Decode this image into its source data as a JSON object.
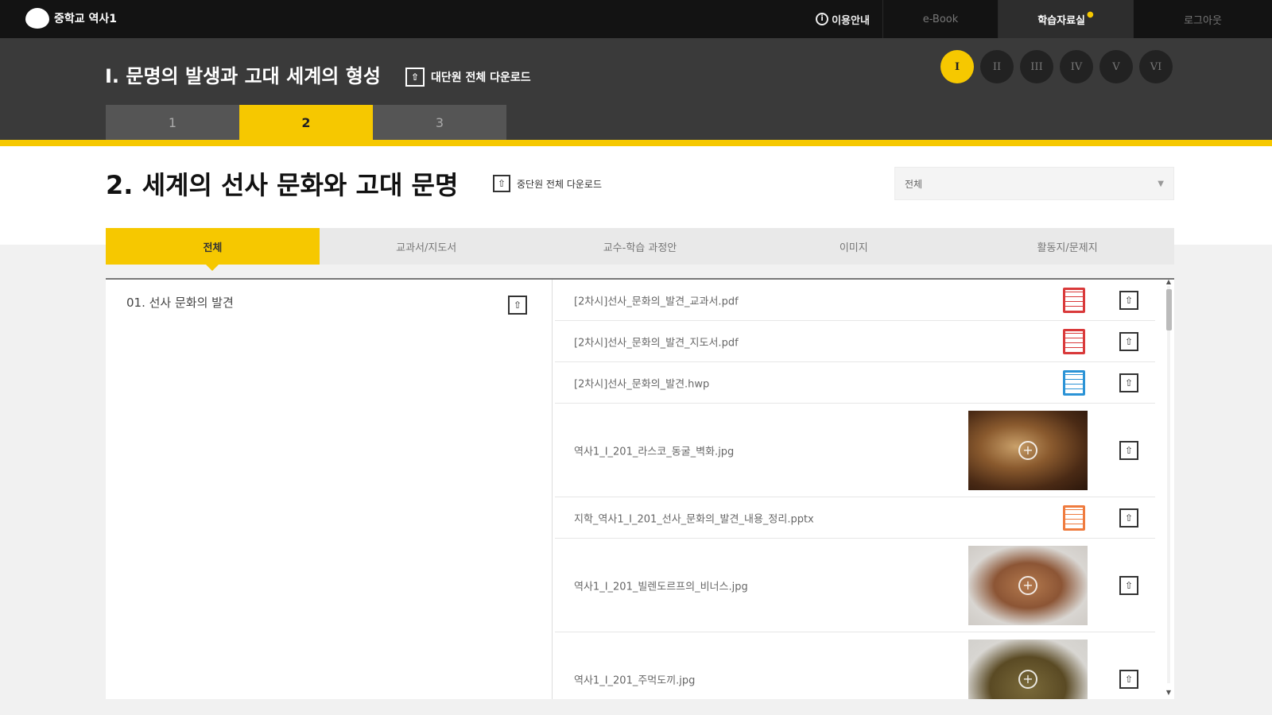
{
  "app": {
    "logo_text": "중학교 역사1"
  },
  "topnav": {
    "guide": "이용안내",
    "ebook": "e-Book",
    "materials": "학습자료실",
    "logout": "로그아웃"
  },
  "unit": {
    "title": "I. 문명의 발생과 고대 세계의 형성",
    "download_label": "대단원 전체 다운로드",
    "circles": [
      "I",
      "II",
      "III",
      "IV",
      "V",
      "VI"
    ],
    "active_circle": "I"
  },
  "chapter_tabs": [
    "1",
    "2",
    "3"
  ],
  "section": {
    "title": "2. 세계의 선사 문화와 고대 문명",
    "download_label": "중단원 전체 다운로드",
    "filter_value": "전체"
  },
  "category_tabs": [
    "전체",
    "교과서/지도서",
    "교수-학습 과정안",
    "이미지",
    "활동지/문제지"
  ],
  "lesson": {
    "title": "01. 선사 문화의 발견"
  },
  "files": [
    {
      "name": "[2차시]선사_문화의_발견_교과서.pdf",
      "type": "pdf"
    },
    {
      "name": "[2차시]선사_문화의_발견_지도서.pdf",
      "type": "pdf"
    },
    {
      "name": "[2차시]선사_문화의_발견.hwp",
      "type": "hwp"
    },
    {
      "name": "역사1_Ⅰ_201_라스코_동굴_벽화.jpg",
      "type": "image"
    },
    {
      "name": "지학_역사1_Ⅰ_201_선사_문화의_발견_내용_정리.pptx",
      "type": "pptx"
    },
    {
      "name": "역사1_Ⅰ_201_빌렌도르프의_비너스.jpg",
      "type": "image"
    },
    {
      "name": "역사1_Ⅰ_201_주먹도끼.jpg",
      "type": "image"
    }
  ],
  "icons": {
    "download": "download-icon",
    "zoom": "zoom-in-icon",
    "info": "info-icon"
  },
  "colors": {
    "accent": "#f6c800",
    "top_bar": "#131313",
    "unit_bar": "#3a3a3a",
    "pdf": "#d9393a",
    "hwp": "#2b93d6",
    "pptx": "#ef7b3e"
  }
}
